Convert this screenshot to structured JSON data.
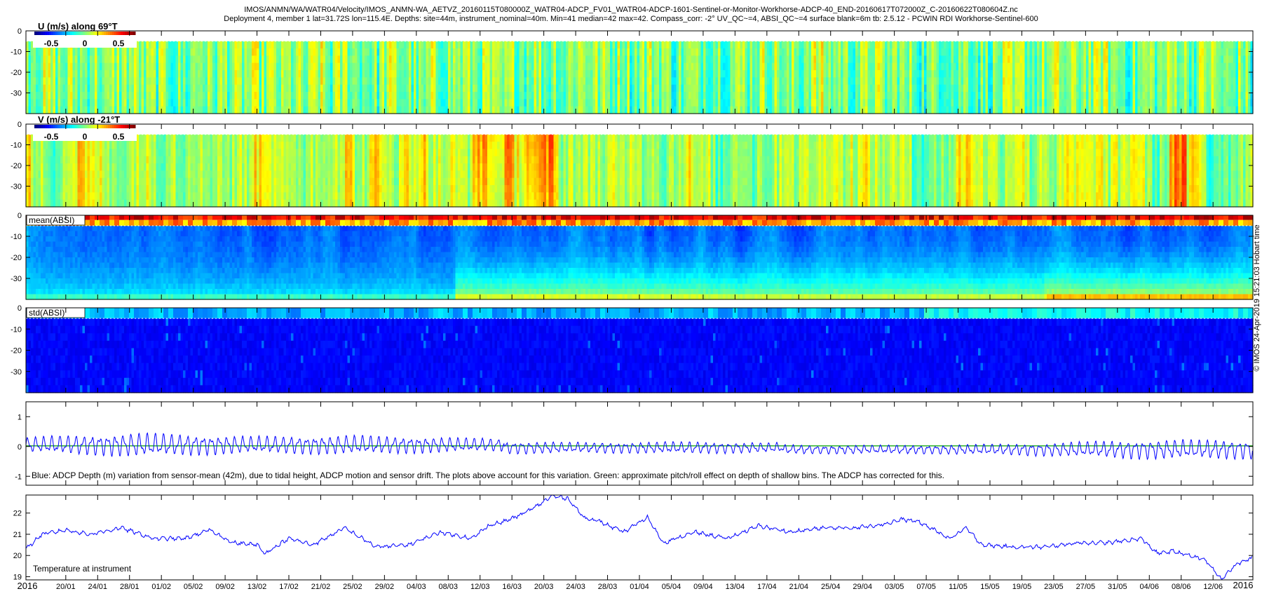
{
  "figure": {
    "title_line1": "IMOS/ANMN/WA/WATR04/Velocity/IMOS_ANMN-WA_AETVZ_20160115T080000Z_WATR04-ADCP_FV01_WATR04-ADCP-1601-Sentinel-or-Monitor-Workhorse-ADCP-40_END-20160617T072000Z_C-20160622T080604Z.nc",
    "title_line2": "Deployment 4, member 1 lat=31.72S lon=115.4E. Depths: site=44m, instrument_nominal=40m. Min=41 median=42 max=42. Compass_corr: -2° UV_QC~=4, ABSI_QC~=4 surface blank=6m tb: 2.5.12 - PCWIN RDI Workhorse-Sentinel-600",
    "side_note": "© IMOS 24-Apr-2019 15:21:03 Hobart time"
  },
  "chart_data": [
    {
      "type": "heatmap",
      "id": "u",
      "label": "U (m/s) along 69°T",
      "colorbar_ticks": [
        "-0.5",
        "0",
        "0.5"
      ],
      "clim": [
        -0.75,
        0.75
      ],
      "ylim": [
        -40,
        0
      ],
      "yticks": [
        "0",
        "-10",
        "-20",
        "-30"
      ],
      "surface_blank_depth": -5
    },
    {
      "type": "heatmap",
      "id": "v",
      "label": "V (m/s) along -21°T",
      "colorbar_ticks": [
        "-0.5",
        "0",
        "0.5"
      ],
      "clim": [
        -0.75,
        0.75
      ],
      "ylim": [
        -40,
        0
      ],
      "yticks": [
        "0",
        "-10",
        "-20",
        "-30"
      ],
      "surface_blank_depth": -5
    },
    {
      "type": "heatmap",
      "id": "mean_absi",
      "label": "mean(ABSI)",
      "ylim": [
        -40,
        0
      ],
      "yticks": [
        "0",
        "-10",
        "-20",
        "-30"
      ],
      "surface_blank_depth": -5
    },
    {
      "type": "heatmap",
      "id": "std_absi",
      "label": "std(ABSI)",
      "ylim": [
        -40,
        0
      ],
      "yticks": [
        "0",
        "-10",
        "-20",
        "-30"
      ],
      "surface_blank_depth": -5
    },
    {
      "type": "line",
      "id": "depth",
      "annotation": "Blue: ADCP Depth (m) variation from sensor-mean (42m), due to tidal height, ADCP motion and sensor drift. The plots above account for this variation. Green: approximate pitch/roll effect on depth of shallow bins. The ADCP has corrected for this.",
      "ylim": [
        -1.3,
        1.5
      ],
      "yticks": [
        "1",
        "0",
        "-1"
      ],
      "series": [
        {
          "color": "#0000ff",
          "x_days": [
            0,
            14,
            28,
            42,
            56,
            70,
            84,
            98,
            112,
            126,
            140,
            154
          ],
          "amplitude": [
            0.18,
            0.28,
            0.2,
            0.22,
            0.16,
            0.12,
            0.14,
            0.1,
            0.1,
            0.14,
            0.22,
            0.22
          ]
        },
        {
          "color": "#00a000",
          "y": 0.02
        }
      ]
    },
    {
      "type": "line",
      "id": "temperature",
      "annotation": "Temperature at instrument",
      "ylim": [
        18.85,
        22.85
      ],
      "yticks": [
        "22",
        "21",
        "20",
        "19"
      ],
      "series": [
        {
          "color": "#0000ff",
          "x_days": [
            0,
            2,
            5,
            8,
            12,
            16,
            20,
            23,
            26,
            29,
            30,
            33,
            36,
            40,
            44,
            48,
            52,
            56,
            58,
            60,
            62,
            64,
            66,
            68,
            70,
            72,
            75,
            78,
            80,
            84,
            88,
            92,
            96,
            100,
            104,
            108,
            110,
            112,
            116,
            118,
            120,
            124,
            128,
            132,
            136,
            140,
            142,
            144,
            146,
            148,
            150,
            152,
            154
          ],
          "y": [
            20.3,
            21.0,
            21.2,
            21.0,
            21.3,
            20.8,
            20.8,
            21.2,
            20.6,
            20.5,
            20.1,
            20.8,
            20.5,
            21.3,
            20.4,
            20.5,
            21.1,
            20.8,
            21.4,
            21.6,
            21.9,
            22.3,
            22.8,
            22.7,
            21.8,
            21.6,
            21.1,
            21.8,
            20.6,
            21.1,
            20.8,
            21.4,
            21.1,
            21.3,
            21.3,
            21.5,
            21.7,
            21.6,
            20.8,
            21.3,
            20.5,
            20.4,
            20.4,
            20.6,
            20.6,
            20.8,
            20.1,
            20.2,
            20.0,
            19.8,
            18.9,
            19.6,
            19.9
          ]
        }
      ]
    }
  ],
  "time_axis": {
    "xlim_days": [
      0,
      154
    ],
    "first_tick_day": 5,
    "tick_step_days": 4,
    "labels": [
      "20/01",
      "24/01",
      "28/01",
      "01/02",
      "05/02",
      "09/02",
      "13/02",
      "17/02",
      "21/02",
      "25/02",
      "29/02",
      "04/03",
      "08/03",
      "12/03",
      "16/03",
      "20/03",
      "24/03",
      "28/03",
      "01/04",
      "05/04",
      "09/04",
      "13/04",
      "17/04",
      "21/04",
      "25/04",
      "29/04",
      "03/05",
      "07/05",
      "11/05",
      "15/05",
      "19/05",
      "23/05",
      "27/05",
      "31/05",
      "04/06",
      "08/06",
      "12/06"
    ],
    "year_left": "2016",
    "year_right": "2016"
  }
}
